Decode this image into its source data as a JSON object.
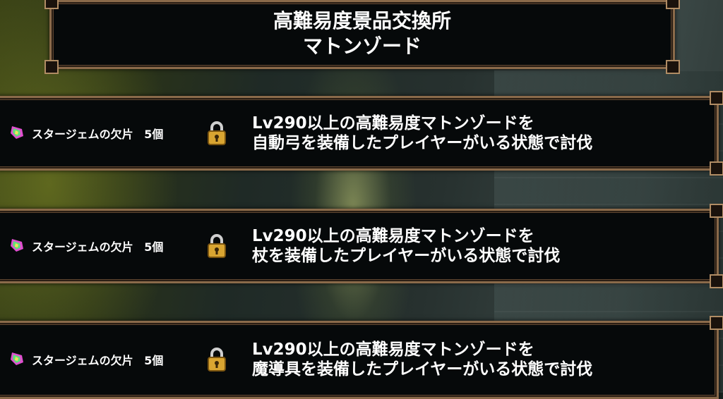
{
  "header": {
    "title_line1": "高難易度景品交換所",
    "title_line2": "マトンゾード"
  },
  "rows": [
    {
      "reward": "スタージェムの欠片",
      "count": "5個",
      "locked": true,
      "condition_line1": "Lv290以上の高難易度マトンゾードを",
      "condition_line2": "自動弓を装備したプレイヤーがいる状態で討伐"
    },
    {
      "reward": "スタージェムの欠片",
      "count": "5個",
      "locked": true,
      "condition_line1": "Lv290以上の高難易度マトンゾードを",
      "condition_line2": "杖を装備したプレイヤーがいる状態で討伐"
    },
    {
      "reward": "スタージェムの欠片",
      "count": "5個",
      "locked": true,
      "condition_line1": "Lv290以上の高難易度マトンゾードを",
      "condition_line2": "魔導具を装備したプレイヤーがいる状態で討伐"
    }
  ],
  "icons": {
    "reward": "star-gem-fragment-icon",
    "lock": "padlock-icon"
  },
  "colors": {
    "frame_border": "#8a6a4a",
    "panel_bg": "#06090a",
    "text": "#ffffff",
    "lock_gold": "#d9a531"
  }
}
